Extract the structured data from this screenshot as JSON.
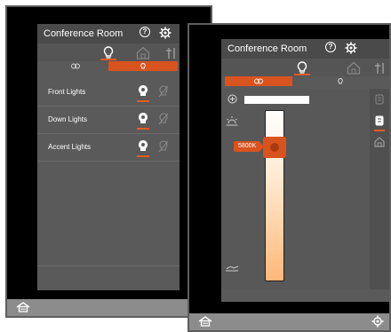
{
  "panel_left": {
    "title": "Conference Room",
    "rows": [
      {
        "label": "Front Lights"
      },
      {
        "label": "Down Lights"
      },
      {
        "label": "Accent Lights"
      }
    ]
  },
  "panel_right": {
    "title": "Conference Room",
    "color_temp": "5800K",
    "level": 0.82
  },
  "colors": {
    "accent": "#e55a25",
    "panel": "#5a5a5a",
    "bezel": "#8c8c8c"
  }
}
